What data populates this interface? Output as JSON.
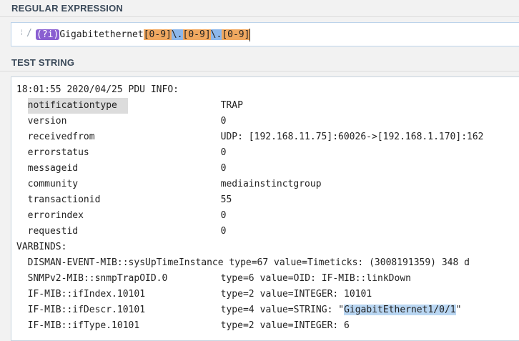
{
  "regex_section": {
    "title": "REGULAR EXPRESSION",
    "grip": "⁞",
    "delimiter": "/",
    "tokens": {
      "group": "(?i)",
      "literal": "Gigabitethernet",
      "set1": "[0-9]",
      "dot1": "\\.",
      "set2": "[0-9]",
      "dot2": "\\.",
      "set3": "[0-9]"
    }
  },
  "test_section": {
    "title": "TEST STRING",
    "header": "18:01:55 2020/04/25 PDU INFO:",
    "fields": [
      {
        "key": "notificationtype",
        "value": "TRAP"
      },
      {
        "key": "version",
        "value": "0"
      },
      {
        "key": "receivedfrom",
        "value": "UDP: [192.168.11.75]:60026->[192.168.1.170]:162"
      },
      {
        "key": "errorstatus",
        "value": "0"
      },
      {
        "key": "messageid",
        "value": "0"
      },
      {
        "key": "community",
        "value": "mediainstinctgroup"
      },
      {
        "key": "transactionid",
        "value": "55"
      },
      {
        "key": "errorindex",
        "value": "0"
      },
      {
        "key": "requestid",
        "value": "0"
      }
    ],
    "varbinds_label": "VARBINDS:",
    "varbinds": [
      {
        "oid": "DISMAN-EVENT-MIB::sysUpTimeInstance type=67 value=Timeticks: (3008191359) 348 d"
      },
      {
        "oid": "SNMPv2-MIB::snmpTrapOID.0",
        "type": "type=6",
        "value": "value=OID: IF-MIB::linkDown"
      },
      {
        "oid": "IF-MIB::ifIndex.10101",
        "type": "type=2",
        "value": "value=INTEGER: 10101"
      },
      {
        "oid": "IF-MIB::ifDescr.10101",
        "type": "type=4",
        "value_prefix": "value=STRING: \"",
        "match": "GigabitEthernet1/0/1",
        "value_suffix": "\""
      },
      {
        "oid": "IF-MIB::ifType.10101",
        "type": "type=2",
        "value": "value=INTEGER: 6"
      }
    ]
  },
  "colors": {
    "group_token": "#8a5fd1",
    "charset_token": "#f0a860",
    "escape_token": "#8db7ea",
    "match_highlight": "#b9d6f2",
    "selection_highlight": "#dcdcdc"
  }
}
